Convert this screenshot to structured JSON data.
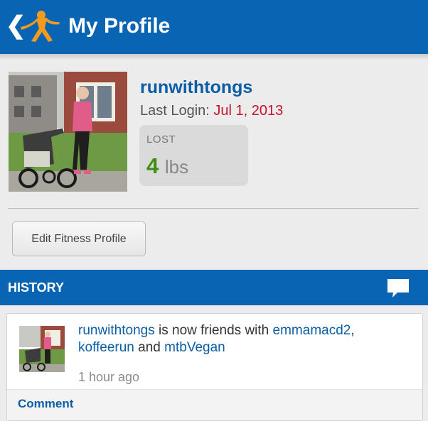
{
  "header": {
    "back_icon": "chevron-left-icon",
    "logo_icon": "figure-logo-icon",
    "title": "My Profile"
  },
  "profile": {
    "username": "runwithtongs",
    "last_login_label": "Last Login:",
    "last_login_date": "Jul 1, 2013",
    "lost_label": "LOST",
    "lost_value": "4",
    "lost_unit": "lbs",
    "edit_button": "Edit Fitness Profile"
  },
  "history": {
    "title": "HISTORY",
    "message_icon": "message-bubble-icon",
    "items": [
      {
        "actor": "runwithtongs",
        "text_mid": "is now friends with",
        "friend_1": "emmamacd2",
        "friend_2": "koffeerun",
        "connector": "and",
        "friend_3": "mtbVegan",
        "time": "1 hour ago",
        "comment_label": "Comment"
      }
    ]
  },
  "colors": {
    "header_blue": "#0a64b4",
    "link_blue": "#0a5da6",
    "date_red": "#c8102e",
    "lost_green": "#3f8f0f"
  }
}
